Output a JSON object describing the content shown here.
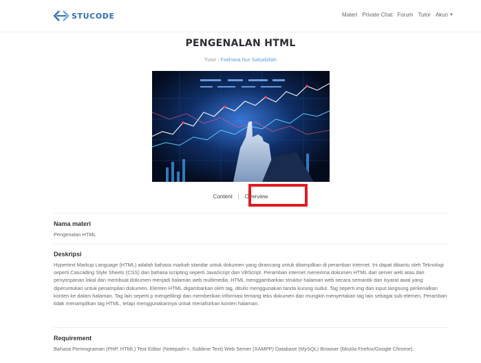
{
  "brand": {
    "name": "STUCODE"
  },
  "nav": {
    "items": [
      "Materi",
      "Private Chat",
      "Forum",
      "Tutor"
    ],
    "account": "Akun"
  },
  "page": {
    "title": "PENGENALAN HTML",
    "tutor_label": "Tutor :",
    "tutor_name": "Fatihana Nur Salsabillah"
  },
  "tabs": {
    "content": "Content",
    "separator": "|",
    "overview": "Overview"
  },
  "sections": {
    "name": {
      "heading": "Nama materi",
      "text": "Pengenalan HTML"
    },
    "description": {
      "heading": "Deskripsi",
      "text": "Hypertext Markup Language (HTML) adalah bahasa markah standar untuk dokumen yang dirancang untuk ditampilkan di peramban internet. Ini dapat dibantu oleh Teknologi seperti Cascading Style Sheets (CSS) dan bahasa scripting seperti JavaScript dan VBScript. Peramban internet menerima dokumen HTML dari server web atau dari penyimpanan lokal dan membuat dokumen menjadi halaman web multimedia. HTML menggambarkan struktur halaman web secara semantik dan isyarat awal yang diperuntukan untuk penampilan dokumen. Elemen HTML digambarkan oleh tag, ditulis menggunakan tanda kurung sudut. Tag seperti img dan input langsung perkenalkan konten ke dalam halaman. Tag lain seperti p mengelilingi dan memberikan informasi tentang teks dokumen dan mungkin menyertakan tag lain sebagai sub-elemen. Peramban tidak menampilkan tag HTML, tetapi menggunakannya untuk menafsirkan konten halaman."
    },
    "requirement": {
      "heading": "Requirement",
      "text": "Bahasa Pemrograman (PHP, HTML) Text Editor (Notepad++, Sublime Text) Web Server (XAMPP) Database (MySQL) Browser (Mozila Firefox/Google Chrome)."
    }
  },
  "colors": {
    "brand": "#2f6fb5",
    "link": "#5aa0d8",
    "highlight": "#e01b22"
  },
  "icons": {
    "logo": "code-brackets-logo-icon",
    "caret": "caret-down-icon"
  }
}
